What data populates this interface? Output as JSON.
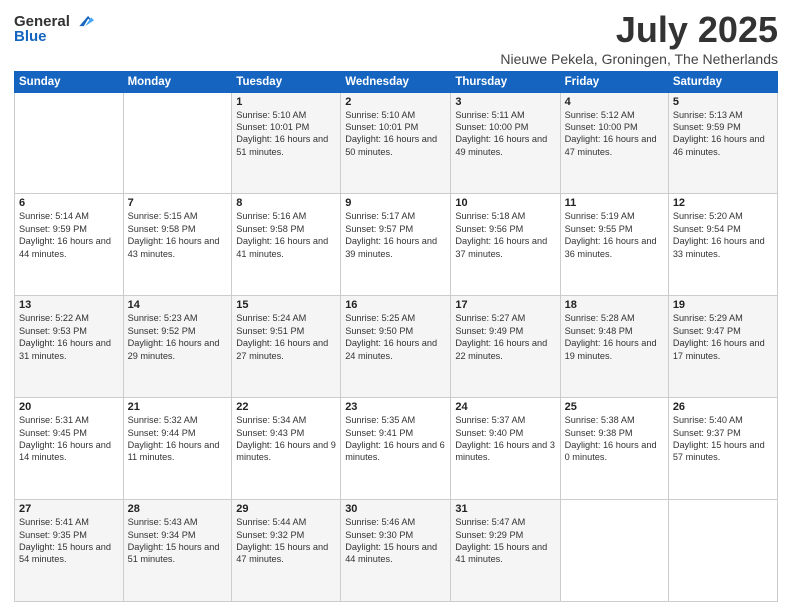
{
  "logo": {
    "general": "General",
    "blue": "Blue"
  },
  "header": {
    "month": "July 2025",
    "location": "Nieuwe Pekela, Groningen, The Netherlands"
  },
  "days_of_week": [
    "Sunday",
    "Monday",
    "Tuesday",
    "Wednesday",
    "Thursday",
    "Friday",
    "Saturday"
  ],
  "weeks": [
    [
      {
        "day": "",
        "content": ""
      },
      {
        "day": "",
        "content": ""
      },
      {
        "day": "1",
        "content": "Sunrise: 5:10 AM\nSunset: 10:01 PM\nDaylight: 16 hours and 51 minutes."
      },
      {
        "day": "2",
        "content": "Sunrise: 5:10 AM\nSunset: 10:01 PM\nDaylight: 16 hours and 50 minutes."
      },
      {
        "day": "3",
        "content": "Sunrise: 5:11 AM\nSunset: 10:00 PM\nDaylight: 16 hours and 49 minutes."
      },
      {
        "day": "4",
        "content": "Sunrise: 5:12 AM\nSunset: 10:00 PM\nDaylight: 16 hours and 47 minutes."
      },
      {
        "day": "5",
        "content": "Sunrise: 5:13 AM\nSunset: 9:59 PM\nDaylight: 16 hours and 46 minutes."
      }
    ],
    [
      {
        "day": "6",
        "content": "Sunrise: 5:14 AM\nSunset: 9:59 PM\nDaylight: 16 hours and 44 minutes."
      },
      {
        "day": "7",
        "content": "Sunrise: 5:15 AM\nSunset: 9:58 PM\nDaylight: 16 hours and 43 minutes."
      },
      {
        "day": "8",
        "content": "Sunrise: 5:16 AM\nSunset: 9:58 PM\nDaylight: 16 hours and 41 minutes."
      },
      {
        "day": "9",
        "content": "Sunrise: 5:17 AM\nSunset: 9:57 PM\nDaylight: 16 hours and 39 minutes."
      },
      {
        "day": "10",
        "content": "Sunrise: 5:18 AM\nSunset: 9:56 PM\nDaylight: 16 hours and 37 minutes."
      },
      {
        "day": "11",
        "content": "Sunrise: 5:19 AM\nSunset: 9:55 PM\nDaylight: 16 hours and 36 minutes."
      },
      {
        "day": "12",
        "content": "Sunrise: 5:20 AM\nSunset: 9:54 PM\nDaylight: 16 hours and 33 minutes."
      }
    ],
    [
      {
        "day": "13",
        "content": "Sunrise: 5:22 AM\nSunset: 9:53 PM\nDaylight: 16 hours and 31 minutes."
      },
      {
        "day": "14",
        "content": "Sunrise: 5:23 AM\nSunset: 9:52 PM\nDaylight: 16 hours and 29 minutes."
      },
      {
        "day": "15",
        "content": "Sunrise: 5:24 AM\nSunset: 9:51 PM\nDaylight: 16 hours and 27 minutes."
      },
      {
        "day": "16",
        "content": "Sunrise: 5:25 AM\nSunset: 9:50 PM\nDaylight: 16 hours and 24 minutes."
      },
      {
        "day": "17",
        "content": "Sunrise: 5:27 AM\nSunset: 9:49 PM\nDaylight: 16 hours and 22 minutes."
      },
      {
        "day": "18",
        "content": "Sunrise: 5:28 AM\nSunset: 9:48 PM\nDaylight: 16 hours and 19 minutes."
      },
      {
        "day": "19",
        "content": "Sunrise: 5:29 AM\nSunset: 9:47 PM\nDaylight: 16 hours and 17 minutes."
      }
    ],
    [
      {
        "day": "20",
        "content": "Sunrise: 5:31 AM\nSunset: 9:45 PM\nDaylight: 16 hours and 14 minutes."
      },
      {
        "day": "21",
        "content": "Sunrise: 5:32 AM\nSunset: 9:44 PM\nDaylight: 16 hours and 11 minutes."
      },
      {
        "day": "22",
        "content": "Sunrise: 5:34 AM\nSunset: 9:43 PM\nDaylight: 16 hours and 9 minutes."
      },
      {
        "day": "23",
        "content": "Sunrise: 5:35 AM\nSunset: 9:41 PM\nDaylight: 16 hours and 6 minutes."
      },
      {
        "day": "24",
        "content": "Sunrise: 5:37 AM\nSunset: 9:40 PM\nDaylight: 16 hours and 3 minutes."
      },
      {
        "day": "25",
        "content": "Sunrise: 5:38 AM\nSunset: 9:38 PM\nDaylight: 16 hours and 0 minutes."
      },
      {
        "day": "26",
        "content": "Sunrise: 5:40 AM\nSunset: 9:37 PM\nDaylight: 15 hours and 57 minutes."
      }
    ],
    [
      {
        "day": "27",
        "content": "Sunrise: 5:41 AM\nSunset: 9:35 PM\nDaylight: 15 hours and 54 minutes."
      },
      {
        "day": "28",
        "content": "Sunrise: 5:43 AM\nSunset: 9:34 PM\nDaylight: 15 hours and 51 minutes."
      },
      {
        "day": "29",
        "content": "Sunrise: 5:44 AM\nSunset: 9:32 PM\nDaylight: 15 hours and 47 minutes."
      },
      {
        "day": "30",
        "content": "Sunrise: 5:46 AM\nSunset: 9:30 PM\nDaylight: 15 hours and 44 minutes."
      },
      {
        "day": "31",
        "content": "Sunrise: 5:47 AM\nSunset: 9:29 PM\nDaylight: 15 hours and 41 minutes."
      },
      {
        "day": "",
        "content": ""
      },
      {
        "day": "",
        "content": ""
      }
    ]
  ]
}
